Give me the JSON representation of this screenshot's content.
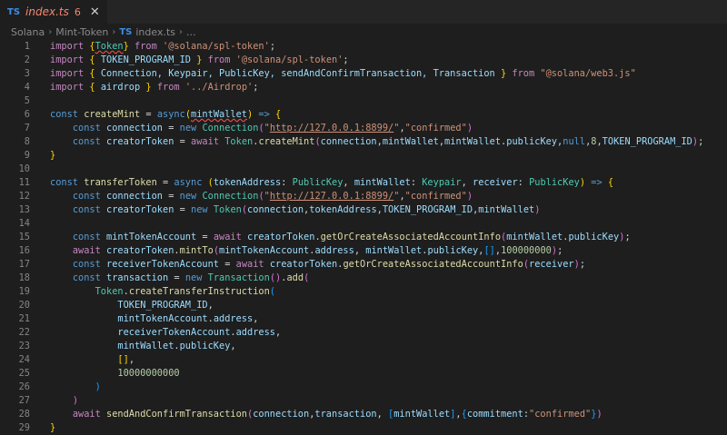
{
  "tab": {
    "badge": "TS",
    "title": "index.ts",
    "problem_count": "6"
  },
  "breadcrumb": {
    "items": [
      "Solana",
      "Mint-Token",
      "index.ts",
      "..."
    ],
    "badge": "TS"
  },
  "editor": {
    "lines": [
      {
        "n": 1,
        "tokens": [
          [
            "ctl",
            "import "
          ],
          [
            "br1",
            "{"
          ],
          [
            "ty squig",
            "Token"
          ],
          [
            "br1",
            "}"
          ],
          [
            "ctl",
            " from "
          ],
          [
            "str",
            "'@solana/spl-token'"
          ],
          [
            "txt",
            ";"
          ]
        ]
      },
      {
        "n": 2,
        "tokens": [
          [
            "ctl",
            "import "
          ],
          [
            "br1",
            "{ "
          ],
          [
            "var",
            "TOKEN_PROGRAM_ID"
          ],
          [
            "br1",
            " }"
          ],
          [
            "ctl",
            " from "
          ],
          [
            "str",
            "'@solana/spl-token'"
          ],
          [
            "txt",
            ";"
          ]
        ]
      },
      {
        "n": 3,
        "tokens": [
          [
            "ctl",
            "import "
          ],
          [
            "br1",
            "{ "
          ],
          [
            "var",
            "Connection, Keypair, PublicKey, sendAndConfirmTransaction, Transaction"
          ],
          [
            "br1",
            " }"
          ],
          [
            "ctl",
            " from "
          ],
          [
            "str",
            "\"@solana/web3.js\""
          ]
        ]
      },
      {
        "n": 4,
        "tokens": [
          [
            "ctl",
            "import "
          ],
          [
            "br1",
            "{ "
          ],
          [
            "var",
            "airdrop"
          ],
          [
            "br1",
            " }"
          ],
          [
            "ctl",
            " from "
          ],
          [
            "str",
            "'../Airdrop'"
          ],
          [
            "txt",
            ";"
          ]
        ]
      },
      {
        "n": 5,
        "tokens": []
      },
      {
        "n": 6,
        "tokens": [
          [
            "kw",
            "const "
          ],
          [
            "fn",
            "createMint"
          ],
          [
            "txt",
            " = "
          ],
          [
            "kw",
            "async"
          ],
          [
            "br1",
            "("
          ],
          [
            "var squig",
            "mintWallet"
          ],
          [
            "br1",
            ")"
          ],
          [
            "kw",
            " => "
          ],
          [
            "br1",
            "{"
          ]
        ]
      },
      {
        "n": 7,
        "tokens": [
          [
            "txt",
            "    "
          ],
          [
            "kw",
            "const "
          ],
          [
            "var",
            "connection"
          ],
          [
            "txt",
            " = "
          ],
          [
            "kw",
            "new "
          ],
          [
            "ty",
            "Connection"
          ],
          [
            "br2",
            "("
          ],
          [
            "str",
            "\""
          ],
          [
            "url",
            "http://127.0.0.1:8899/"
          ],
          [
            "str",
            "\""
          ],
          [
            "txt",
            ","
          ],
          [
            "str",
            "\"confirmed\""
          ],
          [
            "br2",
            ")"
          ]
        ]
      },
      {
        "n": 8,
        "tokens": [
          [
            "txt",
            "    "
          ],
          [
            "kw",
            "const "
          ],
          [
            "var",
            "creatorToken"
          ],
          [
            "txt",
            " = "
          ],
          [
            "ctl",
            "await "
          ],
          [
            "ty",
            "Token"
          ],
          [
            "txt",
            "."
          ],
          [
            "fn",
            "createMint"
          ],
          [
            "br2",
            "("
          ],
          [
            "var",
            "connection"
          ],
          [
            "txt",
            ","
          ],
          [
            "var",
            "mintWallet"
          ],
          [
            "txt",
            ","
          ],
          [
            "var",
            "mintWallet"
          ],
          [
            "txt",
            "."
          ],
          [
            "var",
            "publicKey"
          ],
          [
            "txt",
            ","
          ],
          [
            "kw",
            "null"
          ],
          [
            "txt",
            ","
          ],
          [
            "num",
            "8"
          ],
          [
            "txt",
            ","
          ],
          [
            "var",
            "TOKEN_PROGRAM_ID"
          ],
          [
            "br2",
            ")"
          ],
          [
            "txt",
            ";"
          ]
        ]
      },
      {
        "n": 9,
        "tokens": [
          [
            "br1",
            "}"
          ]
        ]
      },
      {
        "n": 10,
        "tokens": []
      },
      {
        "n": 11,
        "tokens": [
          [
            "kw",
            "const "
          ],
          [
            "fn",
            "transferToken"
          ],
          [
            "txt",
            " = "
          ],
          [
            "kw",
            "async "
          ],
          [
            "br1",
            "("
          ],
          [
            "var",
            "tokenAddress"
          ],
          [
            "txt",
            ": "
          ],
          [
            "ty",
            "PublicKey"
          ],
          [
            "txt",
            ", "
          ],
          [
            "var",
            "mintWallet"
          ],
          [
            "txt",
            ": "
          ],
          [
            "ty",
            "Keypair"
          ],
          [
            "txt",
            ", "
          ],
          [
            "var",
            "receiver"
          ],
          [
            "txt",
            ": "
          ],
          [
            "ty",
            "PublicKey"
          ],
          [
            "br1",
            ")"
          ],
          [
            "kw",
            " => "
          ],
          [
            "br1",
            "{"
          ]
        ]
      },
      {
        "n": 12,
        "tokens": [
          [
            "txt",
            "    "
          ],
          [
            "kw",
            "const "
          ],
          [
            "var",
            "connection"
          ],
          [
            "txt",
            " = "
          ],
          [
            "kw",
            "new "
          ],
          [
            "ty",
            "Connection"
          ],
          [
            "br2",
            "("
          ],
          [
            "str",
            "\""
          ],
          [
            "url",
            "http://127.0.0.1:8899/"
          ],
          [
            "str",
            "\""
          ],
          [
            "txt",
            ","
          ],
          [
            "str",
            "\"confirmed\""
          ],
          [
            "br2",
            ")"
          ]
        ]
      },
      {
        "n": 13,
        "tokens": [
          [
            "txt",
            "    "
          ],
          [
            "kw",
            "const "
          ],
          [
            "var",
            "creatorToken"
          ],
          [
            "txt",
            " = "
          ],
          [
            "kw",
            "new "
          ],
          [
            "ty",
            "Token"
          ],
          [
            "br2",
            "("
          ],
          [
            "var",
            "connection"
          ],
          [
            "txt",
            ","
          ],
          [
            "var",
            "tokenAddress"
          ],
          [
            "txt",
            ","
          ],
          [
            "var",
            "TOKEN_PROGRAM_ID"
          ],
          [
            "txt",
            ","
          ],
          [
            "var",
            "mintWallet"
          ],
          [
            "br2",
            ")"
          ]
        ]
      },
      {
        "n": 14,
        "tokens": []
      },
      {
        "n": 15,
        "tokens": [
          [
            "txt",
            "    "
          ],
          [
            "kw",
            "const "
          ],
          [
            "var",
            "mintTokenAccount"
          ],
          [
            "txt",
            " = "
          ],
          [
            "ctl",
            "await "
          ],
          [
            "var",
            "creatorToken"
          ],
          [
            "txt",
            "."
          ],
          [
            "fn",
            "getOrCreateAssociatedAccountInfo"
          ],
          [
            "br2",
            "("
          ],
          [
            "var",
            "mintWallet"
          ],
          [
            "txt",
            "."
          ],
          [
            "var",
            "publicKey"
          ],
          [
            "br2",
            ")"
          ],
          [
            "txt",
            ";"
          ]
        ]
      },
      {
        "n": 16,
        "tokens": [
          [
            "txt",
            "    "
          ],
          [
            "ctl",
            "await "
          ],
          [
            "var",
            "creatorToken"
          ],
          [
            "txt",
            "."
          ],
          [
            "fn",
            "mintTo"
          ],
          [
            "br2",
            "("
          ],
          [
            "var",
            "mintTokenAccount"
          ],
          [
            "txt",
            "."
          ],
          [
            "var",
            "address"
          ],
          [
            "txt",
            ", "
          ],
          [
            "var",
            "mintWallet"
          ],
          [
            "txt",
            "."
          ],
          [
            "var",
            "publicKey"
          ],
          [
            "txt",
            ","
          ],
          [
            "br3",
            "[]"
          ],
          [
            "txt",
            ","
          ],
          [
            "num",
            "100000000"
          ],
          [
            "br2",
            ")"
          ],
          [
            "txt",
            ";"
          ]
        ]
      },
      {
        "n": 17,
        "tokens": [
          [
            "txt",
            "    "
          ],
          [
            "kw",
            "const "
          ],
          [
            "var",
            "receiverTokenAccount"
          ],
          [
            "txt",
            " = "
          ],
          [
            "ctl",
            "await "
          ],
          [
            "var",
            "creatorToken"
          ],
          [
            "txt",
            "."
          ],
          [
            "fn",
            "getOrCreateAssociatedAccountInfo"
          ],
          [
            "br2",
            "("
          ],
          [
            "var",
            "receiver"
          ],
          [
            "br2",
            ")"
          ],
          [
            "txt",
            ";"
          ]
        ]
      },
      {
        "n": 18,
        "tokens": [
          [
            "txt",
            "    "
          ],
          [
            "kw",
            "const "
          ],
          [
            "var",
            "transaction"
          ],
          [
            "txt",
            " = "
          ],
          [
            "kw",
            "new "
          ],
          [
            "ty",
            "Transaction"
          ],
          [
            "br2",
            "()"
          ],
          [
            "txt",
            "."
          ],
          [
            "fn",
            "add"
          ],
          [
            "br2",
            "("
          ]
        ]
      },
      {
        "n": 19,
        "tokens": [
          [
            "txt",
            "        "
          ],
          [
            "ty",
            "Token"
          ],
          [
            "txt",
            "."
          ],
          [
            "fn",
            "createTransferInstruction"
          ],
          [
            "br3",
            "("
          ]
        ]
      },
      {
        "n": 20,
        "tokens": [
          [
            "txt",
            "            "
          ],
          [
            "var",
            "TOKEN_PROGRAM_ID"
          ],
          [
            "txt",
            ","
          ]
        ]
      },
      {
        "n": 21,
        "tokens": [
          [
            "txt",
            "            "
          ],
          [
            "var",
            "mintTokenAccount"
          ],
          [
            "txt",
            "."
          ],
          [
            "var",
            "address"
          ],
          [
            "txt",
            ","
          ]
        ]
      },
      {
        "n": 22,
        "tokens": [
          [
            "txt",
            "            "
          ],
          [
            "var",
            "receiverTokenAccount"
          ],
          [
            "txt",
            "."
          ],
          [
            "var",
            "address"
          ],
          [
            "txt",
            ","
          ]
        ]
      },
      {
        "n": 23,
        "tokens": [
          [
            "txt",
            "            "
          ],
          [
            "var",
            "mintWallet"
          ],
          [
            "txt",
            "."
          ],
          [
            "var",
            "publicKey"
          ],
          [
            "txt",
            ","
          ]
        ]
      },
      {
        "n": 24,
        "tokens": [
          [
            "txt",
            "            "
          ],
          [
            "br1",
            "[]"
          ],
          [
            "txt",
            ","
          ]
        ]
      },
      {
        "n": 25,
        "tokens": [
          [
            "txt",
            "            "
          ],
          [
            "num",
            "10000000000"
          ]
        ]
      },
      {
        "n": 26,
        "tokens": [
          [
            "txt",
            "        "
          ],
          [
            "br3",
            ")"
          ]
        ]
      },
      {
        "n": 27,
        "tokens": [
          [
            "txt",
            "    "
          ],
          [
            "br2",
            ")"
          ]
        ]
      },
      {
        "n": 28,
        "tokens": [
          [
            "txt",
            "    "
          ],
          [
            "ctl",
            "await "
          ],
          [
            "fn",
            "sendAndConfirmTransaction"
          ],
          [
            "br2",
            "("
          ],
          [
            "var",
            "connection"
          ],
          [
            "txt",
            ","
          ],
          [
            "var",
            "transaction"
          ],
          [
            "txt",
            ", "
          ],
          [
            "br3",
            "["
          ],
          [
            "var",
            "mintWallet"
          ],
          [
            "br3",
            "]"
          ],
          [
            "txt",
            ","
          ],
          [
            "br3",
            "{"
          ],
          [
            "var",
            "commitment"
          ],
          [
            "txt",
            ":"
          ],
          [
            "str",
            "\"confirmed\""
          ],
          [
            "br3",
            "}"
          ],
          [
            "br2",
            ")"
          ]
        ]
      },
      {
        "n": 29,
        "tokens": [
          [
            "br1",
            "}"
          ]
        ]
      }
    ]
  }
}
